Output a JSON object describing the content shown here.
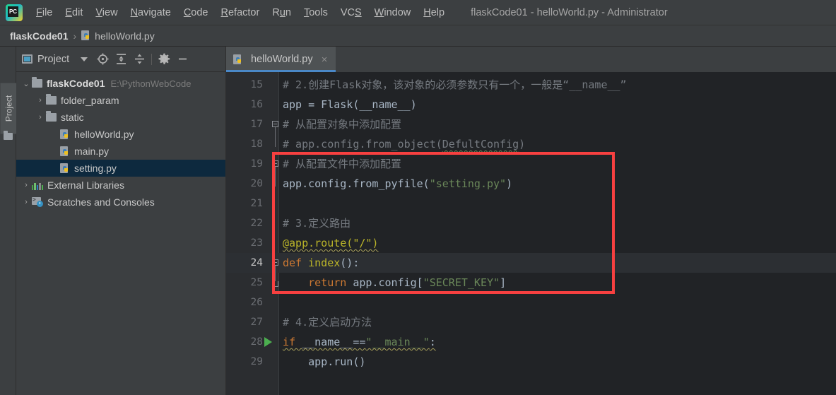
{
  "window": {
    "title": "flaskCode01 - helloWorld.py - Administrator",
    "logo_icon": "pycharm-logo-icon"
  },
  "menubar": {
    "items": [
      {
        "label": "File",
        "mnemonic": "F"
      },
      {
        "label": "Edit",
        "mnemonic": "E"
      },
      {
        "label": "View",
        "mnemonic": "V"
      },
      {
        "label": "Navigate",
        "mnemonic": "N"
      },
      {
        "label": "Code",
        "mnemonic": "C"
      },
      {
        "label": "Refactor",
        "mnemonic": "R"
      },
      {
        "label": "Run",
        "mnemonic": "u"
      },
      {
        "label": "Tools",
        "mnemonic": "T"
      },
      {
        "label": "VCS",
        "mnemonic": "S"
      },
      {
        "label": "Window",
        "mnemonic": "W"
      },
      {
        "label": "Help",
        "mnemonic": "H"
      }
    ]
  },
  "breadcrumb": {
    "project": "flaskCode01",
    "separator": "›",
    "file": "helloWorld.py",
    "file_icon": "python-file-icon"
  },
  "tool_strip": {
    "vertical_tab": "Project",
    "folder_icon": "folder-icon"
  },
  "project_panel": {
    "title": "Project",
    "window_icon": "project-window-icon",
    "toolbar": [
      {
        "name": "dropdown-caret-icon",
        "label": "▾"
      },
      {
        "name": "scroll-from-source-icon",
        "label": "⊕"
      },
      {
        "name": "expand-all-icon",
        "label": "⬍"
      },
      {
        "name": "collapse-all-icon",
        "label": "⬌"
      },
      {
        "name": "settings-gear-icon",
        "label": "⚙"
      },
      {
        "name": "hide-panel-icon",
        "label": "—"
      }
    ],
    "tree": [
      {
        "label": "flaskCode01",
        "path": "E:\\PythonWebCode",
        "icon": "folder-icon",
        "arrow": "⌄",
        "expanded": true,
        "indent": 0,
        "bold": true,
        "selected": false
      },
      {
        "label": "folder_param",
        "path": "",
        "icon": "folder-icon",
        "arrow": "›",
        "expanded": false,
        "indent": 1,
        "bold": false,
        "selected": false
      },
      {
        "label": "static",
        "path": "",
        "icon": "folder-icon",
        "arrow": "›",
        "expanded": false,
        "indent": 1,
        "bold": false,
        "selected": false
      },
      {
        "label": "helloWorld.py",
        "path": "",
        "icon": "python-file-icon",
        "arrow": "",
        "expanded": false,
        "indent": 2,
        "bold": false,
        "selected": false
      },
      {
        "label": "main.py",
        "path": "",
        "icon": "python-file-icon",
        "arrow": "",
        "expanded": false,
        "indent": 2,
        "bold": false,
        "selected": false
      },
      {
        "label": "setting.py",
        "path": "",
        "icon": "python-file-icon",
        "arrow": "",
        "expanded": false,
        "indent": 2,
        "bold": false,
        "selected": true
      },
      {
        "label": "External Libraries",
        "path": "",
        "icon": "libraries-icon",
        "arrow": "›",
        "expanded": false,
        "indent": 0,
        "bold": false,
        "selected": false
      },
      {
        "label": "Scratches and Consoles",
        "path": "",
        "icon": "scratches-icon",
        "arrow": "›",
        "expanded": false,
        "indent": 0,
        "bold": false,
        "selected": false
      }
    ]
  },
  "editor": {
    "tab": {
      "name": "helloWorld.py",
      "icon": "python-file-icon",
      "close_label": "×",
      "active": true
    },
    "current_line": 24,
    "run_marker_line": 28,
    "first_visible_line": 15,
    "lines": [
      {
        "n": 15,
        "tokens": [
          {
            "t": "# 2.创建Flask对象，该对象的必须参数只有一个，一般是“__name__”",
            "c": "cm"
          }
        ]
      },
      {
        "n": 16,
        "tokens": [
          {
            "t": "app = Flask(__name__)",
            "c": "pl"
          }
        ]
      },
      {
        "n": 17,
        "tokens": [
          {
            "t": "# 从配置对象中添加配置",
            "c": "cm"
          }
        ]
      },
      {
        "n": 18,
        "tokens": [
          {
            "t": "# app.config.from_object(",
            "c": "cm"
          },
          {
            "t": "DefultConfig",
            "c": "cm wavy-g"
          },
          {
            "t": ")",
            "c": "cm"
          }
        ]
      },
      {
        "n": 19,
        "tokens": [
          {
            "t": "# 从配置文件中添加配置",
            "c": "cm"
          }
        ]
      },
      {
        "n": 20,
        "tokens": [
          {
            "t": "app.config.from_pyfile(",
            "c": "pl"
          },
          {
            "t": "\"setting.py\"",
            "c": "str"
          },
          {
            "t": ")",
            "c": "pl"
          }
        ]
      },
      {
        "n": 21,
        "tokens": []
      },
      {
        "n": 22,
        "tokens": [
          {
            "t": "# 3.定义路由",
            "c": "cm"
          }
        ]
      },
      {
        "n": 23,
        "tokens": [
          {
            "t": "@app.route(\"/\")",
            "c": "dec wavy"
          }
        ]
      },
      {
        "n": 24,
        "tokens": [
          {
            "t": "def ",
            "c": "kw"
          },
          {
            "t": "index",
            "c": "dec"
          },
          {
            "t": "():",
            "c": "pl"
          }
        ]
      },
      {
        "n": 25,
        "tokens": [
          {
            "t": "    return ",
            "c": "kw"
          },
          {
            "t": "app.config[",
            "c": "pl"
          },
          {
            "t": "\"SECRET_KEY\"",
            "c": "str"
          },
          {
            "t": "]",
            "c": "pl"
          }
        ]
      },
      {
        "n": 26,
        "tokens": []
      },
      {
        "n": 27,
        "tokens": [
          {
            "t": "# 4.定义启动方法",
            "c": "cm"
          }
        ]
      },
      {
        "n": 28,
        "tokens": [
          {
            "t": "if ",
            "c": "kw wavy"
          },
          {
            "t": "__name__==",
            "c": "pl wavy"
          },
          {
            "t": "\"__main__\"",
            "c": "str wavy"
          },
          {
            "t": ":",
            "c": "pl wavy"
          }
        ]
      },
      {
        "n": 29,
        "tokens": [
          {
            "t": "    app.run()",
            "c": "pl"
          }
        ]
      }
    ],
    "annotation": {
      "type": "red-rectangle",
      "color": "#f74040",
      "covers_lines": "19-25"
    }
  },
  "colors": {
    "chrome_bg": "#3c3f41",
    "editor_bg": "#212326",
    "gutter_bg": "#2b2d30",
    "selection_blue": "#0d293e",
    "tab_underline": "#4a88c7",
    "annotation_red": "#f74040",
    "run_green": "#4caf50",
    "keyword_orange": "#cc7832",
    "string_green": "#6a8759",
    "decorator_yellow": "#bbb529",
    "comment_gray": "#757a80",
    "plain_text": "#a9b7c6"
  }
}
